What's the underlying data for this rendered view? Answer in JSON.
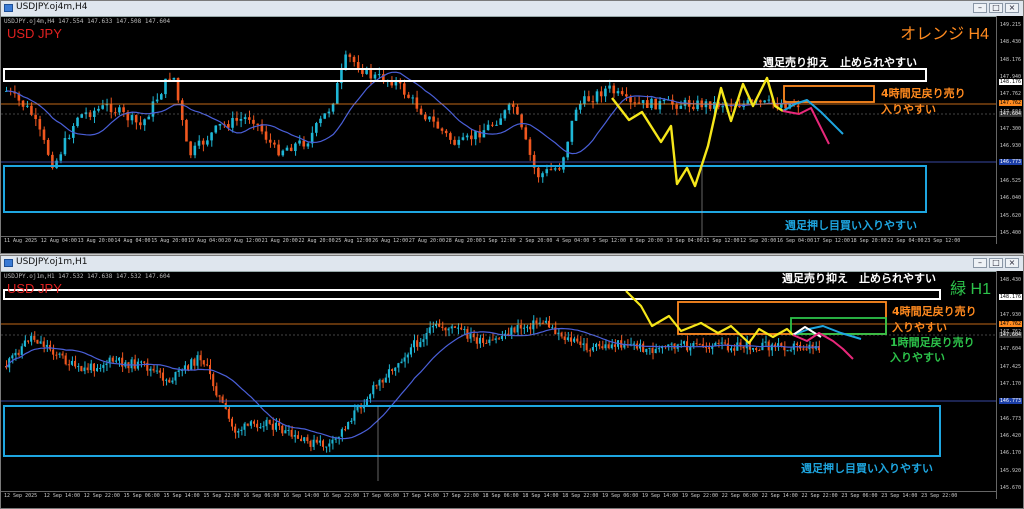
{
  "chart_h4": {
    "window_title": "USDJPY.oj4m,H4",
    "ohlc_line": "USDJPY.oj4m,H4  147.554 147.633 147.508 147.604",
    "symbol_label": "USD JPY",
    "timeframe_label": "オレンジ H4",
    "annotations": {
      "weekly_sell_resistance": "週足売り抑え　止められやすい",
      "h4_pullback_sell_1": "4時間足戻り売り",
      "h4_pullback_sell_2": "入りやすい",
      "weekly_dip_buy": "週足押し目買い入りやすい"
    },
    "y_ticks": [
      "149.215",
      "148.430",
      "148.176",
      "147.940",
      "147.762",
      "147.604",
      "147.300",
      "146.930",
      "146.773",
      "146.525",
      "146.040",
      "145.620",
      "145.400"
    ],
    "x_ticks": [
      "11 Aug 2025",
      "12 Aug 04:00",
      "13 Aug 20:00",
      "14 Aug 04:00",
      "15 Aug 20:00",
      "19 Aug 04:00",
      "20 Aug 12:00",
      "21 Aug 20:00",
      "22 Aug 20:00",
      "25 Aug 12:00",
      "26 Aug 12:00",
      "27 Aug 20:00",
      "28 Aug 20:00",
      "1 Sep 12:00",
      "2 Sep 20:00",
      "4 Sep 04:00",
      "5 Sep 12:00",
      "8 Sep 20:00",
      "10 Sep 04:00",
      "11 Sep 12:00",
      "12 Sep 20:00",
      "16 Sep 04:00",
      "17 Sep 12:00",
      "18 Sep 20:00",
      "22 Sep 04:00",
      "23 Sep 12:00"
    ],
    "price_tags": {
      "white": "148.176",
      "orange": "147.762",
      "current": "147.604",
      "blue": "146.773"
    }
  },
  "chart_h1": {
    "window_title": "USDJPY.oj1m,H1",
    "ohlc_line": "USDJPY.oj1m,H1  147.532 147.638 147.532 147.604",
    "symbol_label": "USD JPY",
    "timeframe_label": "緑 H1",
    "annotations": {
      "weekly_sell_resistance": "週足売り抑え　止められやすい",
      "h4_pullback_sell_1": "4時間足戻り売り",
      "h4_pullback_sell_2": "入りやすい",
      "h1_pullback_sell_1": "1時間足戻り売り",
      "h1_pullback_sell_2": "入りやすい",
      "weekly_dip_buy": "週足押し目買い入りやすい"
    },
    "y_ticks": [
      "148.430",
      "148.176",
      "147.930",
      "147.762",
      "147.604",
      "147.425",
      "147.170",
      "146.920",
      "146.773",
      "146.420",
      "146.170",
      "145.920",
      "145.670"
    ],
    "x_ticks": [
      "12 Sep 2025",
      "12 Sep 14:00",
      "12 Sep 22:00",
      "15 Sep 06:00",
      "15 Sep 14:00",
      "15 Sep 22:00",
      "16 Sep 06:00",
      "16 Sep 14:00",
      "16 Sep 22:00",
      "17 Sep 06:00",
      "17 Sep 14:00",
      "17 Sep 22:00",
      "18 Sep 06:00",
      "18 Sep 14:00",
      "18 Sep 22:00",
      "19 Sep 06:00",
      "19 Sep 14:00",
      "19 Sep 22:00",
      "22 Sep 06:00",
      "22 Sep 14:00",
      "22 Sep 22:00",
      "23 Sep 06:00",
      "23 Sep 14:00",
      "23 Sep 22:00"
    ],
    "price_tags": {
      "white": "148.176",
      "orange": "147.762",
      "current": "147.604",
      "blue": "146.773"
    }
  },
  "colors": {
    "bull": "#1fb7d6",
    "bear": "#f0571f",
    "ma": "#4a5fd8",
    "zigzag": "#f5e61a",
    "orange": "#ff8a1f",
    "blue_box": "#1ea6e0",
    "green": "#2cc24a",
    "pink": "#e8287a",
    "white": "#ffffff"
  },
  "window_buttons": {
    "minimize": "–",
    "maximize": "□",
    "close": "×"
  }
}
